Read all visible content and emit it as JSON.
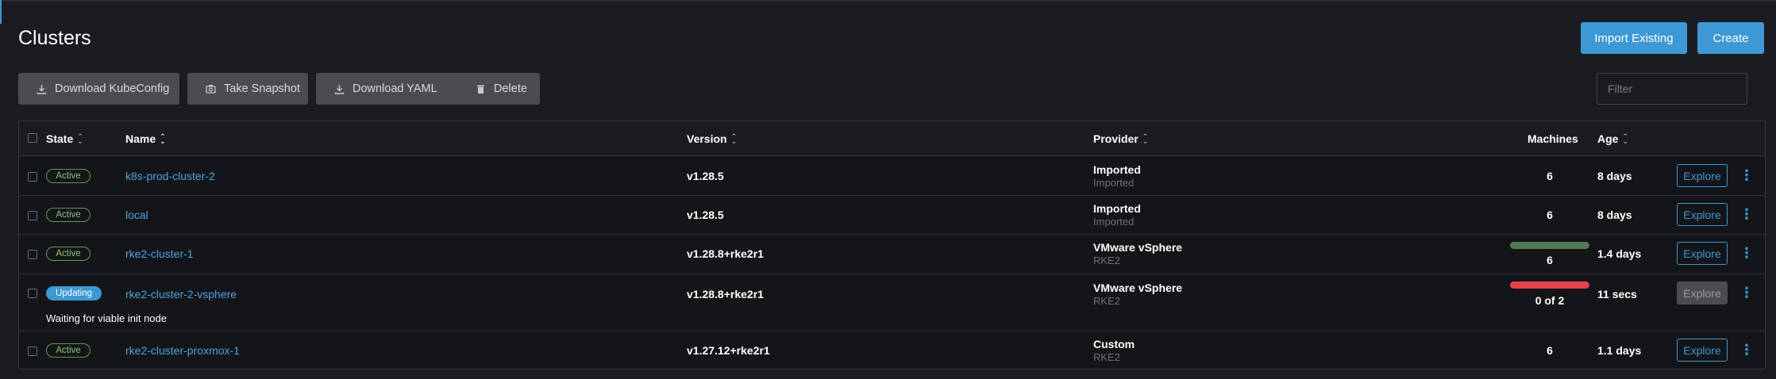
{
  "page": {
    "title": "Clusters",
    "import_label": "Import Existing",
    "create_label": "Create"
  },
  "toolbar": {
    "download_kubeconfig": "Download KubeConfig",
    "take_snapshot": "Take Snapshot",
    "download_yaml": "Download YAML",
    "delete": "Delete",
    "filter_placeholder": "Filter"
  },
  "table": {
    "columns": {
      "state": "State",
      "name": "Name",
      "version": "Version",
      "provider": "Provider",
      "machines": "Machines",
      "age": "Age"
    },
    "explore_label": "Explore",
    "rows": [
      {
        "state": "Active",
        "name": "k8s-prod-cluster-2",
        "version": "v1.28.5",
        "provider": "Imported",
        "provider_sub": "Imported",
        "machines": "6",
        "age": "8 days"
      },
      {
        "state": "Active",
        "name": "local",
        "version": "v1.28.5",
        "provider": "Imported",
        "provider_sub": "Imported",
        "machines": "6",
        "age": "8 days"
      },
      {
        "state": "Active",
        "name": "rke2-cluster-1",
        "version": "v1.28.8+rke2r1",
        "provider": "VMware vSphere",
        "provider_sub": "RKE2",
        "machines": "6",
        "machines_ready_fraction": 1.0,
        "age": "1.4 days"
      },
      {
        "state": "Updating",
        "name": "rke2-cluster-2-vsphere",
        "version": "v1.28.8+rke2r1",
        "provider": "VMware vSphere",
        "provider_sub": "RKE2",
        "machines": "0 of 2",
        "machines_ready_fraction": 0.0,
        "age": "11 secs",
        "message": "Waiting for viable init node"
      },
      {
        "state": "Active",
        "name": "rke2-cluster-proxmox-1",
        "version": "v1.27.12+rke2r1",
        "provider": "Custom",
        "provider_sub": "RKE2",
        "machines": "6",
        "age": "1.1 days"
      }
    ]
  },
  "colors": {
    "accent": "#3d98d3",
    "active_badge": "#5d9c4c",
    "ready_bar": "#4f7a55",
    "error_bar": "#e6424a"
  }
}
